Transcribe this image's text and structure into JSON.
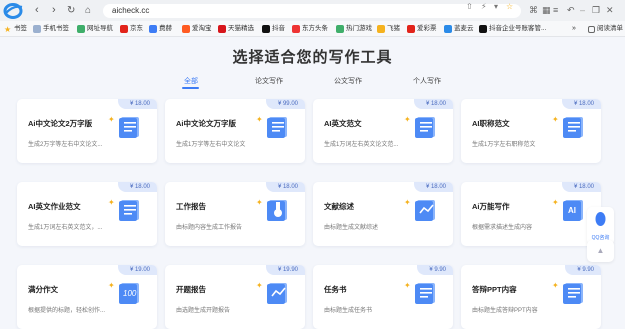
{
  "browser": {
    "url": "aicheck.cc",
    "sidebar_mode": "阅读清单"
  },
  "bookmarks": [
    "书签",
    "手机书签",
    "网址导航",
    "京东",
    "费赫",
    "爱淘宝",
    "天猫精选",
    "抖音",
    "东方头条",
    "热门游戏",
    "飞猪",
    "爱彩票",
    "蓝麦云",
    "抖音企业号账客管..."
  ],
  "page": {
    "title": "选择适合您的写作工具",
    "tabs": [
      "全部",
      "论文写作",
      "公文写作",
      "个人写作"
    ]
  },
  "cards": [
    {
      "name": "Ai中文论文2万字版",
      "desc": "生成2万字等左右中文论文...",
      "price": "¥ 18.00"
    },
    {
      "name": "Ai中文论文万字版",
      "desc": "生成1万字等左右中文论文",
      "price": "¥ 99.00"
    },
    {
      "name": "AI英文范文",
      "desc": "生成1万词左右英文论文范...",
      "price": "¥ 18.00"
    },
    {
      "name": "AI职称范文",
      "desc": "生成1万字左右职称范文",
      "price": "¥ 18.00"
    },
    {
      "name": "AI英文作业范文",
      "desc": "生成1万词左右英文范文，...",
      "price": "¥ 18.00"
    },
    {
      "name": "工作报告",
      "desc": "由标题内容生成工作报告",
      "price": "¥ 18.00"
    },
    {
      "name": "文献综述",
      "desc": "由标题生成文献综述",
      "price": "¥ 18.00"
    },
    {
      "name": "Ai万能写作",
      "desc": "根据需求描述生成内容",
      "price": "¥ 18.00"
    },
    {
      "name": "满分作文",
      "desc": "根据提供的标题，轻松创作...",
      "price": "¥ 19.00"
    },
    {
      "name": "开题报告",
      "desc": "由选题生成开题报告",
      "price": "¥ 19.90"
    },
    {
      "name": "任务书",
      "desc": "由标题生成任务书",
      "price": "¥ 9.90"
    },
    {
      "name": "答辩PPT内容",
      "desc": "由标题生成答辩PPT内容",
      "price": "¥ 9.90"
    }
  ],
  "side": {
    "qq_label": "QQ咨询",
    "top_label": "▲"
  }
}
